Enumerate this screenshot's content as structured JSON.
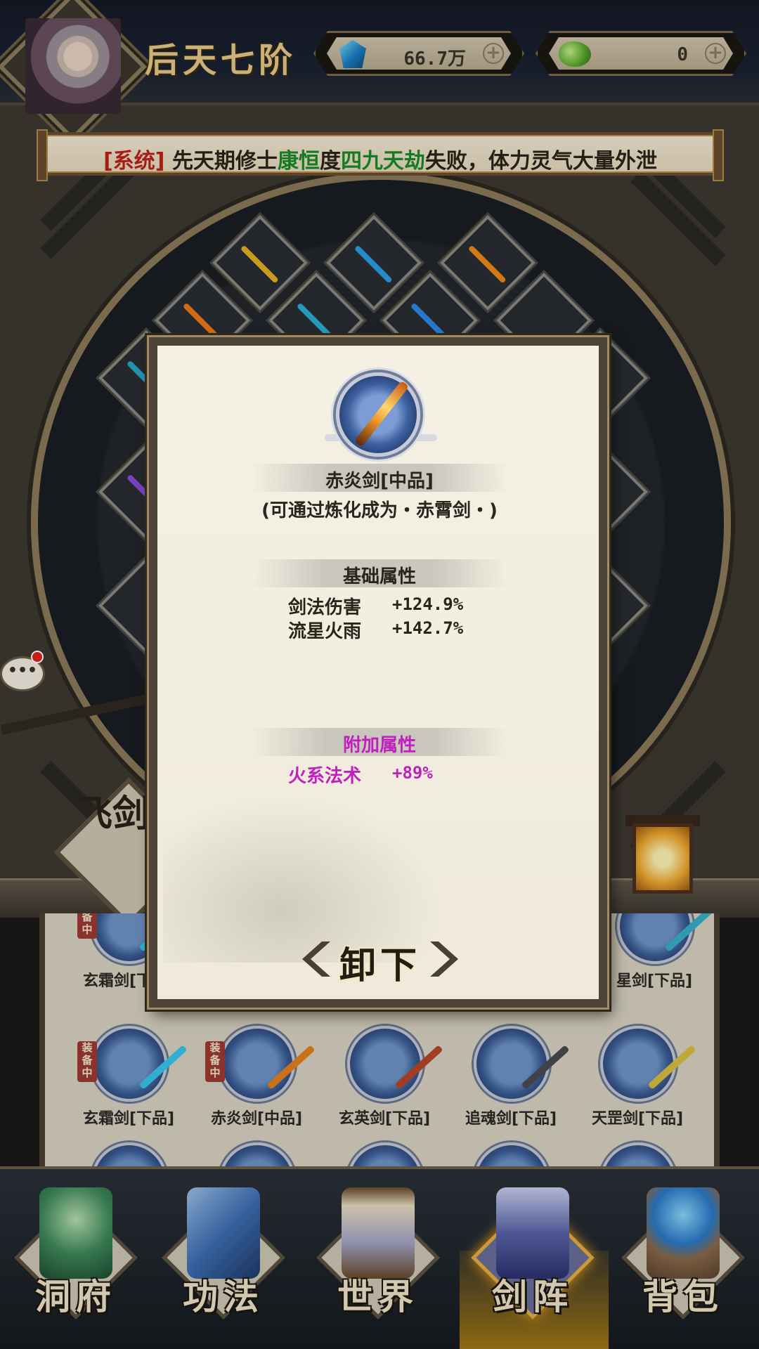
{
  "header": {
    "realm": "后天七阶",
    "currencies": [
      {
        "icon": "spirit-stone-icon",
        "value": "66.7万"
      },
      {
        "icon": "jade-icon",
        "value": "0"
      }
    ]
  },
  "notice": {
    "tag": "[系统]",
    "part1": "先天期修士",
    "name": "康恒",
    "part2": "度",
    "event": "四九天劫",
    "part3": "失败，体力灵气大量外泄"
  },
  "side_tag": "飞剑",
  "chat_bubble": "•••",
  "dialog": {
    "item_name": "赤炎剑[中品]",
    "item_sub": "(可通过炼化成为・赤霄剑・)",
    "base_header": "基础属性",
    "base_attrs": [
      {
        "name": "剑法伤害",
        "value": "+124.9%"
      },
      {
        "name": "流星火雨",
        "value": "+142.7%"
      }
    ],
    "extra_header": "附加属性",
    "extra_attrs": [
      {
        "name": "火系法术",
        "value": "+89%"
      }
    ],
    "unequip_label": "卸下"
  },
  "weapon_list": {
    "row1": [
      {
        "name": "玄霜剑[下品]",
        "equipped": true
      },
      {
        "name": "星剑[下品]",
        "equipped": false
      }
    ],
    "row2": [
      {
        "name": "玄霜剑[下品]",
        "equipped": true
      },
      {
        "name": "赤炎剑[中品]",
        "equipped": true
      },
      {
        "name": "玄英剑[下品]",
        "equipped": false
      },
      {
        "name": "追魂剑[下品]",
        "equipped": false
      },
      {
        "name": "天罡剑[下品]",
        "equipped": false
      }
    ],
    "equipped_badge": "装备中"
  },
  "nav": [
    {
      "label": "洞府",
      "icon": "cave-dwelling-icon"
    },
    {
      "label": "功法",
      "icon": "technique-book-icon"
    },
    {
      "label": "世界",
      "icon": "world-scroll-icon"
    },
    {
      "label": "剑阵",
      "icon": "sword-array-icon",
      "active": true
    },
    {
      "label": "背包",
      "icon": "bag-icon"
    }
  ],
  "colors": {
    "system_tag": "#c0201a",
    "highlight_green": "#1b8a28",
    "extra_attr_purple": "#c21fbf",
    "active_nav_glow": "#d29614"
  }
}
